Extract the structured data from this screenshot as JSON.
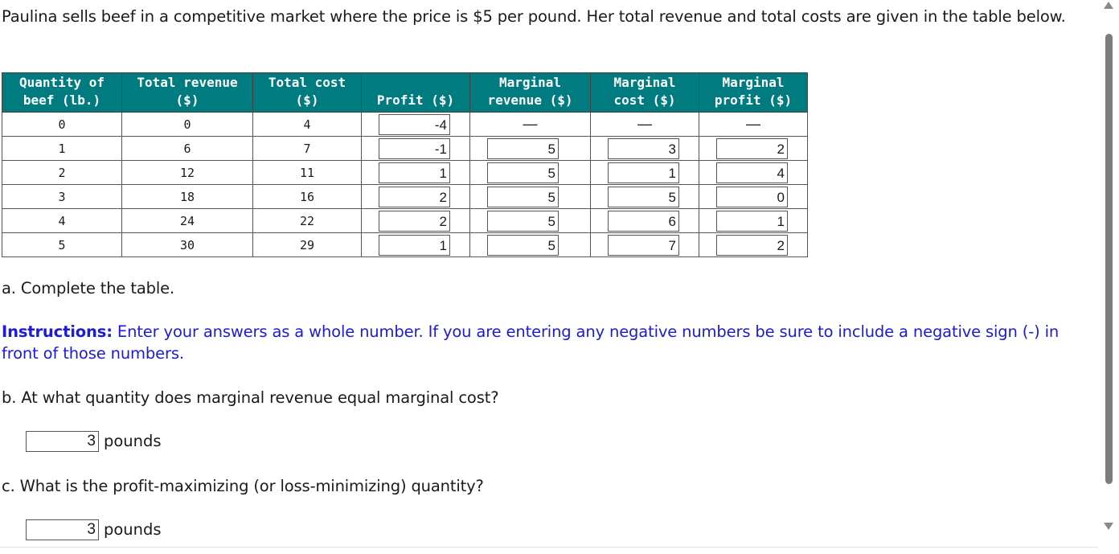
{
  "intro": "Paulina sells beef in a competitive market where the price is $5 per pound. Her total revenue and total costs are given in the table below.",
  "table": {
    "headers": [
      [
        "Quantity of",
        "beef (lb.)"
      ],
      [
        "Total revenue",
        "($)"
      ],
      [
        "Total cost",
        "($)"
      ],
      [
        "",
        "Profit ($)"
      ],
      [
        "Marginal",
        "revenue ($)"
      ],
      [
        "Marginal",
        "cost ($)"
      ],
      [
        "Marginal",
        "profit ($)"
      ]
    ],
    "rows": [
      {
        "quantity": "0",
        "total_revenue": "0",
        "total_cost": "4",
        "profit": "-4",
        "marginal_revenue": "—",
        "marginal_cost": "—",
        "marginal_profit": "—"
      },
      {
        "quantity": "1",
        "total_revenue": "6",
        "total_cost": "7",
        "profit": "-1",
        "marginal_revenue": "5",
        "marginal_cost": "3",
        "marginal_profit": "2"
      },
      {
        "quantity": "2",
        "total_revenue": "12",
        "total_cost": "11",
        "profit": "1",
        "marginal_revenue": "5",
        "marginal_cost": "1",
        "marginal_profit": "4"
      },
      {
        "quantity": "3",
        "total_revenue": "18",
        "total_cost": "16",
        "profit": "2",
        "marginal_revenue": "5",
        "marginal_cost": "5",
        "marginal_profit": "0"
      },
      {
        "quantity": "4",
        "total_revenue": "24",
        "total_cost": "22",
        "profit": "2",
        "marginal_revenue": "5",
        "marginal_cost": "6",
        "marginal_profit": "1"
      },
      {
        "quantity": "5",
        "total_revenue": "30",
        "total_cost": "29",
        "profit": "1",
        "marginal_revenue": "5",
        "marginal_cost": "7",
        "marginal_profit": "2"
      }
    ]
  },
  "part_a": "a. Complete the table.",
  "instructions": {
    "label": "Instructions:",
    "text": " Enter your answers as a whole number. If you are entering any negative numbers be sure to include a negative sign (-) in front of those numbers."
  },
  "part_b": {
    "question": "b. At what quantity does marginal revenue equal marginal cost?",
    "answer": "3",
    "unit": "pounds"
  },
  "part_c": {
    "question": "c. What is the profit-maximizing (or loss-minimizing) quantity?",
    "answer": "3",
    "unit": "pounds"
  },
  "colors": {
    "header_bg": "#007c80",
    "instructions_text": "#1b1bd8"
  }
}
